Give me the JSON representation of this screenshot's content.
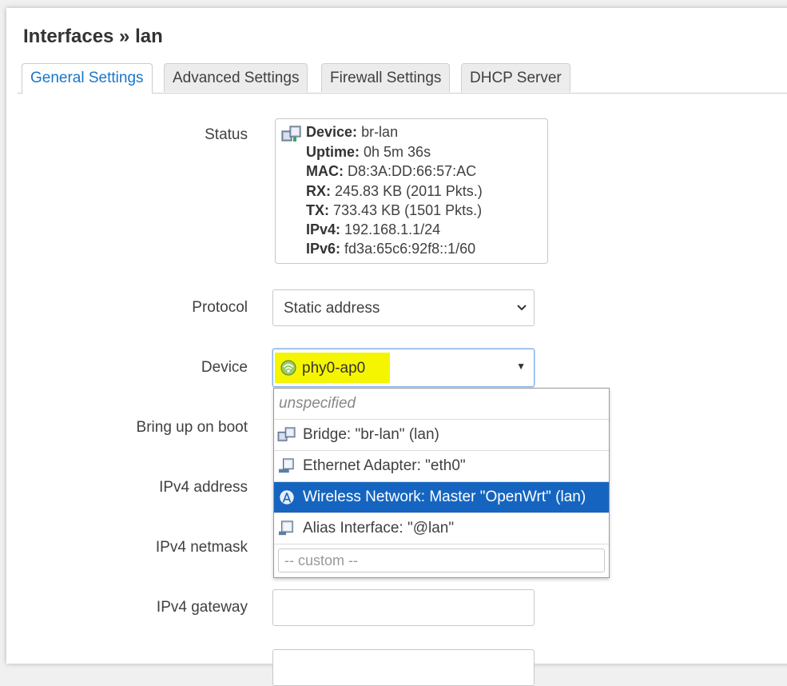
{
  "title": "Interfaces » lan",
  "tabs": [
    "General Settings",
    "Advanced Settings",
    "Firewall Settings",
    "DHCP Server"
  ],
  "labels": {
    "status": "Status",
    "protocol": "Protocol",
    "device": "Device",
    "boot": "Bring up on boot",
    "ipv4_address": "IPv4 address",
    "ipv4_netmask": "IPv4 netmask",
    "ipv4_gateway": "IPv4 gateway"
  },
  "status": {
    "device_label": "Device:",
    "device_value": "br-lan",
    "uptime_label": "Uptime:",
    "uptime_value": "0h 5m 36s",
    "mac_label": "MAC:",
    "mac_value": "D8:3A:DD:66:57:AC",
    "rx_label": "RX:",
    "rx_value": "245.83 KB (2011 Pkts.)",
    "tx_label": "TX:",
    "tx_value": "733.43 KB (1501 Pkts.)",
    "ipv4_label": "IPv4:",
    "ipv4_value": "192.168.1.1/24",
    "ipv6_label": "IPv6:",
    "ipv6_value": "fd3a:65c6:92f8::1/60"
  },
  "protocol_value": "Static address",
  "device_value": "phy0-ap0",
  "highlight_color": "#f5f500",
  "accent_color": "#1976c8",
  "selected_bg": "#1565c0",
  "dropdown": {
    "unspecified": "unspecified",
    "options": [
      {
        "label": "Bridge: \"br-lan\" (lan)",
        "icon": "bridge-icon"
      },
      {
        "label": "Ethernet Adapter: \"eth0\"",
        "icon": "ethernet-icon"
      },
      {
        "label": "Wireless Network: Master \"OpenWrt\" (lan)",
        "icon": "wifi-icon"
      },
      {
        "label": "Alias Interface: \"@lan\"",
        "icon": "alias-icon"
      }
    ],
    "custom_placeholder": "-- custom --"
  }
}
